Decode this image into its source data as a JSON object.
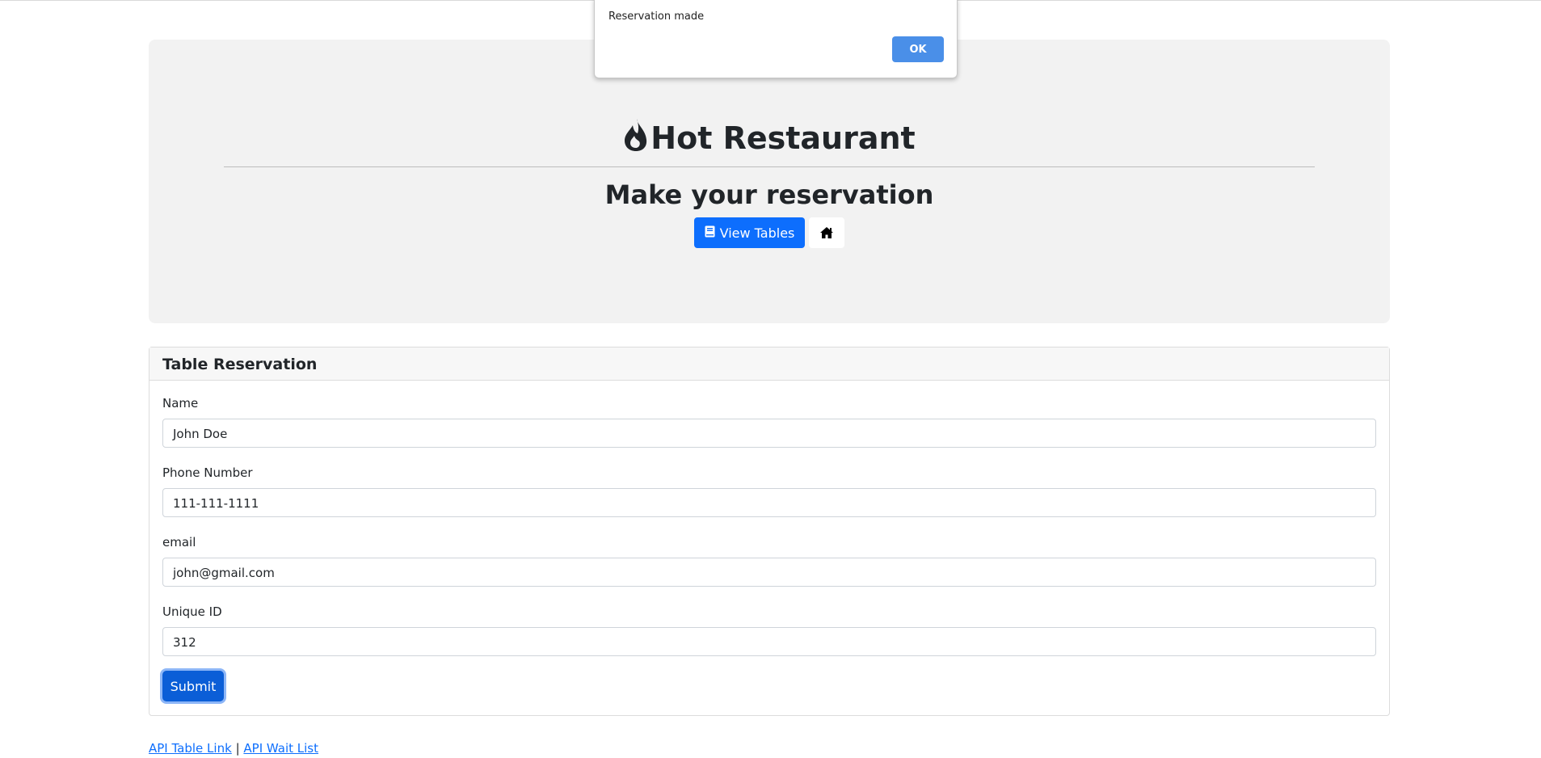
{
  "header": {
    "title": "Hot Restaurant",
    "subtitle": "Make your reservation",
    "view_tables_label": "View Tables"
  },
  "form": {
    "card_title": "Table Reservation",
    "fields": [
      {
        "label": "Name",
        "value": "John Doe"
      },
      {
        "label": "Phone Number",
        "value": "111-111-1111"
      },
      {
        "label": "email",
        "value": "john@gmail.com"
      },
      {
        "label": "Unique ID",
        "value": "312"
      }
    ],
    "submit_label": "Submit"
  },
  "footer": {
    "link1": "API Table Link",
    "separator": "|",
    "link2": "API Wait List"
  },
  "dialog": {
    "message": "Reservation made",
    "ok_label": "OK"
  },
  "colors": {
    "primary": "#0d6efd",
    "dialog_button": "#4a8fe8",
    "jumbotron_bg": "#f2f2f2"
  },
  "icons": {
    "brand": "fire-icon",
    "view_tables": "book-icon",
    "home": "home-icon"
  }
}
